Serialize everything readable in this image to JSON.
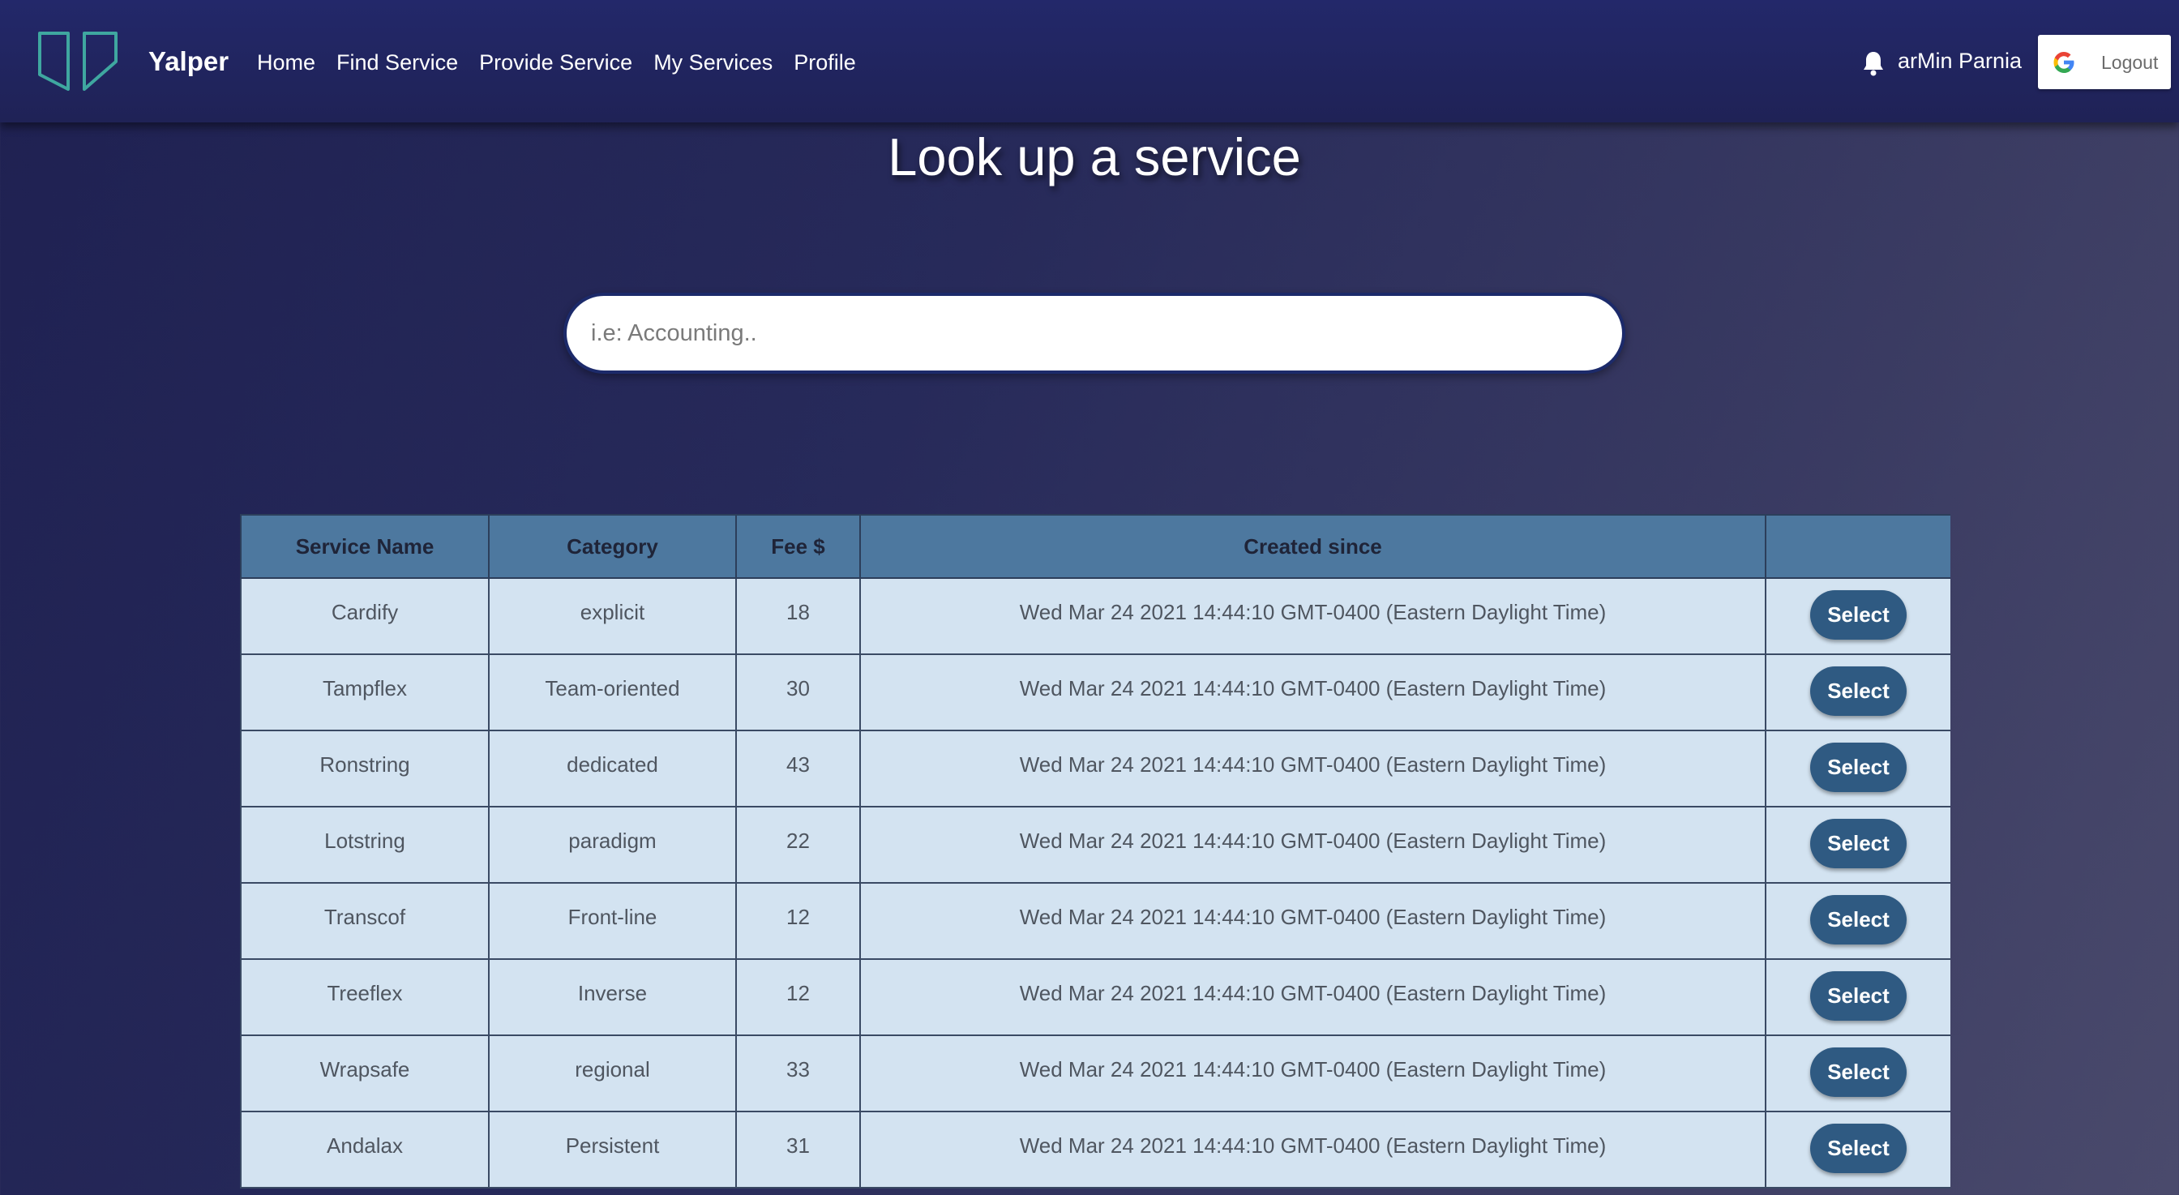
{
  "app": {
    "brand": "Yalper",
    "logo_icon": "yalper-logo-icon"
  },
  "nav": {
    "links": [
      {
        "label": "Home"
      },
      {
        "label": "Find Service"
      },
      {
        "label": "Provide Service"
      },
      {
        "label": "My Services"
      },
      {
        "label": "Profile"
      }
    ],
    "notification_icon": "bell-icon",
    "user_name": "arMin Parnia",
    "logout_label": "Logout",
    "logout_icon": "google-icon"
  },
  "page": {
    "title": "Look up a service"
  },
  "search": {
    "placeholder": "i.e: Accounting..",
    "value": ""
  },
  "table": {
    "headers": [
      "Service Name",
      "Category",
      "Fee $",
      "Created since",
      ""
    ],
    "select_label": "Select",
    "rows": [
      {
        "name": "Cardify",
        "category": "explicit",
        "fee": "18",
        "created": "Wed Mar 24 2021 14:44:10 GMT-0400 (Eastern Daylight Time)"
      },
      {
        "name": "Tampflex",
        "category": "Team-oriented",
        "fee": "30",
        "created": "Wed Mar 24 2021 14:44:10 GMT-0400 (Eastern Daylight Time)"
      },
      {
        "name": "Ronstring",
        "category": "dedicated",
        "fee": "43",
        "created": "Wed Mar 24 2021 14:44:10 GMT-0400 (Eastern Daylight Time)"
      },
      {
        "name": "Lotstring",
        "category": "paradigm",
        "fee": "22",
        "created": "Wed Mar 24 2021 14:44:10 GMT-0400 (Eastern Daylight Time)"
      },
      {
        "name": "Transcof",
        "category": "Front-line",
        "fee": "12",
        "created": "Wed Mar 24 2021 14:44:10 GMT-0400 (Eastern Daylight Time)"
      },
      {
        "name": "Treeflex",
        "category": "Inverse",
        "fee": "12",
        "created": "Wed Mar 24 2021 14:44:10 GMT-0400 (Eastern Daylight Time)"
      },
      {
        "name": "Wrapsafe",
        "category": "regional",
        "fee": "33",
        "created": "Wed Mar 24 2021 14:44:10 GMT-0400 (Eastern Daylight Time)"
      },
      {
        "name": "Andalax",
        "category": "Persistent",
        "fee": "31",
        "created": "Wed Mar 24 2021 14:44:10 GMT-0400 (Eastern Daylight Time)"
      }
    ]
  },
  "colors": {
    "navbar": "#1f2256",
    "header_row": "#4d789f",
    "cell_bg": "#d3e3f1",
    "select_button": "#2f5a82",
    "logo_stroke": "#3fa7a0"
  }
}
